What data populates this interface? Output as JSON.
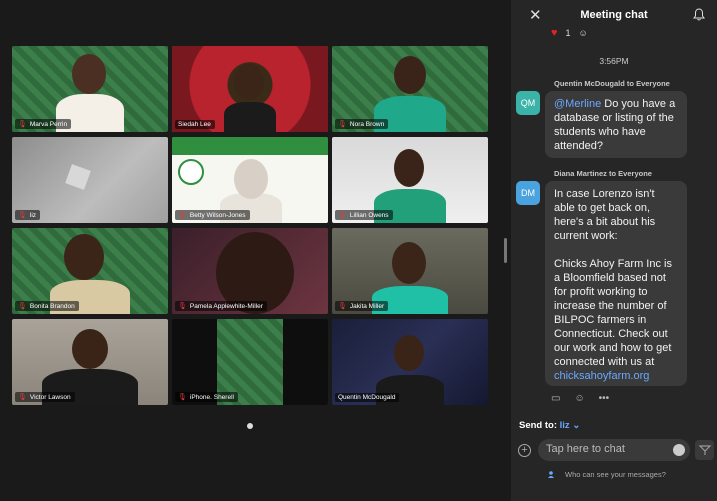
{
  "participants": [
    {
      "name": "Marva Perrin",
      "muted": true
    },
    {
      "name": "Siedah Lee",
      "muted": false
    },
    {
      "name": "Nora Brown",
      "muted": true
    },
    {
      "name": "liz",
      "muted": true
    },
    {
      "name": "Betty Wilson-Jones",
      "muted": true
    },
    {
      "name": "Lillian Owens",
      "muted": true
    },
    {
      "name": "Bonita  Brandon",
      "muted": true
    },
    {
      "name": "Pamela Applewhite-Miller",
      "muted": true
    },
    {
      "name": "Jakita Miller",
      "muted": true
    },
    {
      "name": "Victor Lawson",
      "muted": true
    },
    {
      "name": "iPhone. Sherell",
      "muted": true
    },
    {
      "name": "Quentin McDougald",
      "muted": false
    }
  ],
  "chat": {
    "title": "Meeting chat",
    "reaction": {
      "emoji": "♥",
      "count": "1"
    },
    "timestamp": "3:56PM",
    "messages": [
      {
        "sender": "Quentin McDougald to Everyone",
        "initials": "QM",
        "avatar_color": "#3bb3a8",
        "mention": "@Merline",
        "text": " Do you have a database or listing of the students who have attended?"
      },
      {
        "sender": "Diana Martinez to Everyone",
        "initials": "DM",
        "avatar_color": "#4aa3df",
        "para1": "In case Lorenzo isn't able to get back on, here's a bit about his current work:",
        "para2": "Chicks Ahoy Farm Inc is a Bloomfield based not for profit working to increase the number of BILPOC farmers in Connecticut. Check out our work and how to get connected with us at ",
        "link": "chicksahoyfarm.org"
      }
    ],
    "send_to_label": "Send to:",
    "send_to_target": "liz",
    "input_placeholder": "Tap here to chat",
    "who_can_see": "Who can see your messages?"
  },
  "colors": {
    "active_speaker": "#2ecc40",
    "accent": "#6aa8ff",
    "muted": "#e23b3b"
  }
}
